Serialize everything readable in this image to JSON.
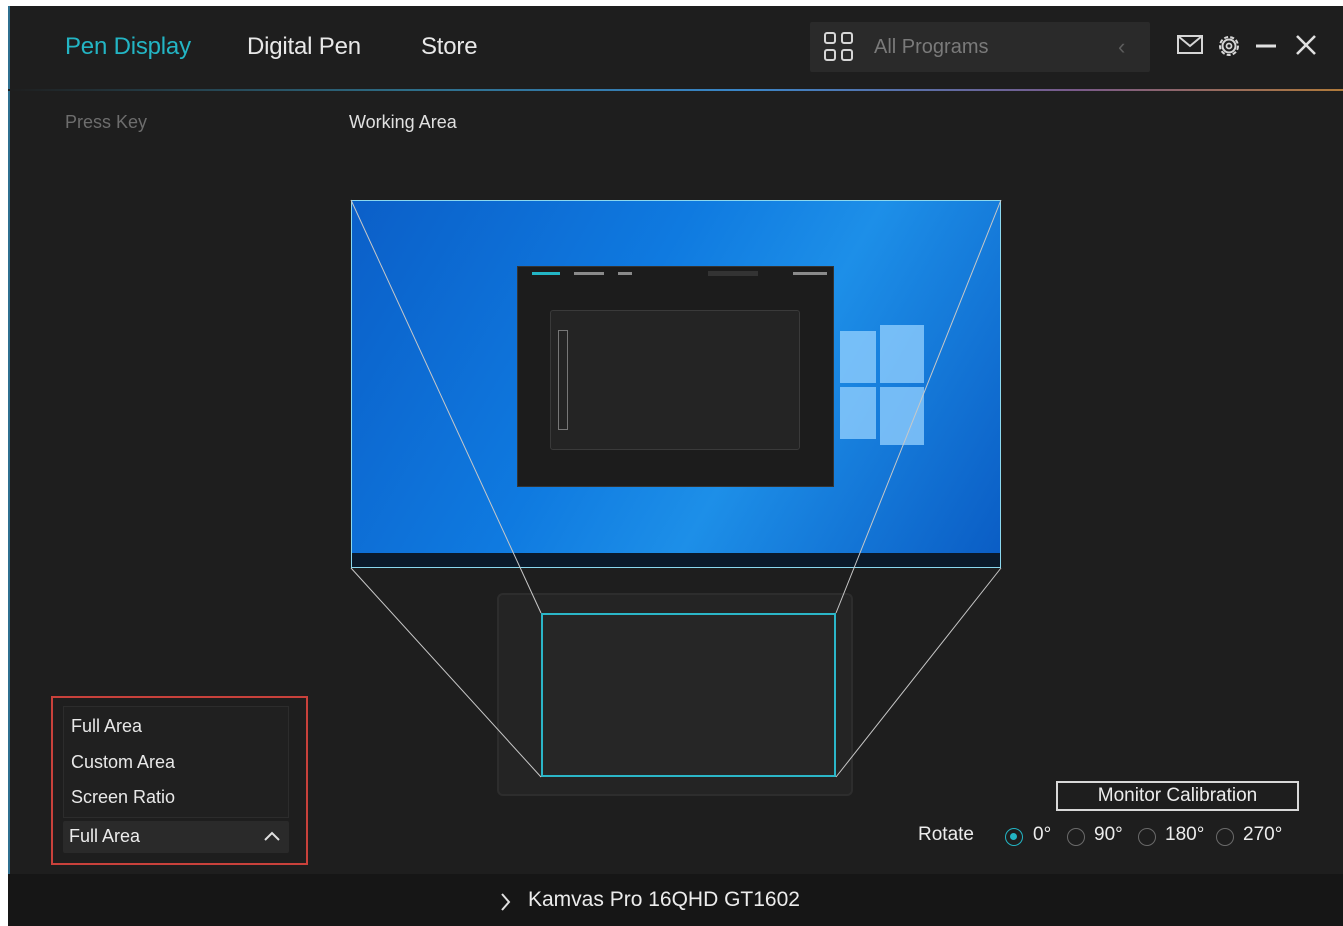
{
  "header": {
    "tabs": [
      {
        "label": "Pen Display",
        "active": true
      },
      {
        "label": "Digital Pen",
        "active": false
      },
      {
        "label": "Store",
        "active": false
      }
    ],
    "program_selector": {
      "label": "All Programs",
      "icon": "grid-icon"
    },
    "window_icons": [
      "mail-icon",
      "gear-icon",
      "minimize-icon",
      "close-icon"
    ]
  },
  "subtabs": [
    {
      "label": "Press Key",
      "active": false
    },
    {
      "label": "Working Area",
      "active": true
    }
  ],
  "area_dropdown": {
    "options": [
      "Full Area",
      "Custom Area",
      "Screen Ratio"
    ],
    "selected": "Full Area"
  },
  "monitor_calibration_label": "Monitor Calibration",
  "rotate": {
    "label": "Rotate",
    "options": [
      "0°",
      "90°",
      "180°",
      "270°"
    ],
    "selected": "0°"
  },
  "device": {
    "name": "Kamvas Pro 16QHD GT1602"
  },
  "colors": {
    "background": "#1e1e1e",
    "accent": "#23b5c4",
    "highlight_box": "#c9413b",
    "footer": "#161616"
  }
}
